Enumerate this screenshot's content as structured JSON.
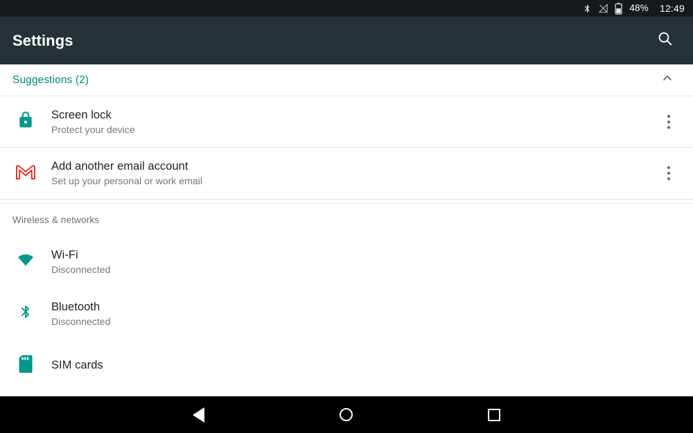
{
  "status_bar": {
    "bluetooth_icon": "bluetooth-icon",
    "signal_icon": "signal-off-icon",
    "battery_icon": "battery-icon",
    "battery_percent": "48%",
    "clock": "12:49"
  },
  "app_bar": {
    "title": "Settings",
    "search_icon": "search-icon"
  },
  "suggestions": {
    "header_label": "Suggestions (2)",
    "collapse_icon": "chevron-up-icon",
    "accent_color": "#00897b",
    "items": [
      {
        "icon": "lock-icon",
        "icon_color": "#009688",
        "title": "Screen lock",
        "subtitle": "Protect your device",
        "overflow_icon": "more-vert-icon"
      },
      {
        "icon": "gmail-icon",
        "icon_color": "#d93025",
        "title": "Add another email account",
        "subtitle": "Set up your personal or work email",
        "overflow_icon": "more-vert-icon"
      }
    ]
  },
  "sections": [
    {
      "header": "Wireless & networks",
      "rows": [
        {
          "icon": "wifi-icon",
          "icon_color": "#009688",
          "title": "Wi-Fi",
          "subtitle": "Disconnected"
        },
        {
          "icon": "bluetooth-icon",
          "icon_color": "#009688",
          "title": "Bluetooth",
          "subtitle": "Disconnected"
        },
        {
          "icon": "sim-card-icon",
          "icon_color": "#009688",
          "title": "SIM cards",
          "subtitle": ""
        }
      ]
    }
  ],
  "nav_bar": {
    "back_label": "back-button",
    "home_label": "home-button",
    "recents_label": "recents-button"
  }
}
